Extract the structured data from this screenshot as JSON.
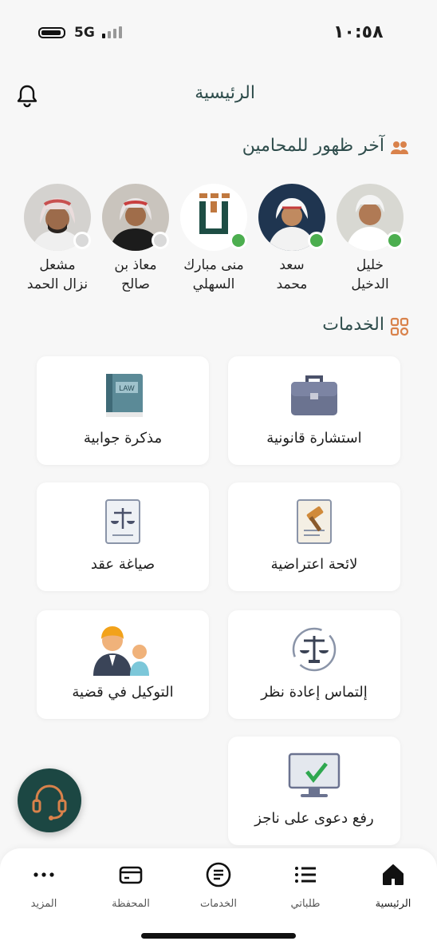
{
  "status_bar": {
    "time": "١٠:٥٨",
    "network": "5G"
  },
  "header": {
    "title": "الرئيسية"
  },
  "lawyers_section": {
    "title": "آخر ظهور للمحامين",
    "items": [
      {
        "name": "خليل\nالدخيل",
        "online": true
      },
      {
        "name": "سعد\nمحمد",
        "online": true
      },
      {
        "name": "منى مبارك\nالسهلي",
        "online": true
      },
      {
        "name": "معاذ بن\nصالح",
        "online": false
      },
      {
        "name": "مشعل\nنزال الحمد",
        "online": false
      }
    ]
  },
  "services_section": {
    "title": "الخدمات",
    "items": [
      {
        "label": "استشارة قانونية",
        "icon": "briefcase-icon"
      },
      {
        "label": "مذكرة جوابية",
        "icon": "law-book-icon"
      },
      {
        "label": "لائحة اعتراضية",
        "icon": "gavel-scroll-icon"
      },
      {
        "label": "صياغة عقد",
        "icon": "scales-scroll-icon"
      },
      {
        "label": "إلتماس إعادة نظر",
        "icon": "scales-refresh-icon"
      },
      {
        "label": "التوكيل في قضية",
        "icon": "people-icon"
      },
      {
        "label": "رفع دعوى على ناجز",
        "icon": "monitor-check-icon"
      }
    ]
  },
  "bottom_nav": {
    "items": [
      {
        "label": "الرئيسية",
        "icon": "home-icon",
        "active": true
      },
      {
        "label": "طلباتي",
        "icon": "list-icon",
        "active": false
      },
      {
        "label": "الخدمات",
        "icon": "services-icon",
        "active": false
      },
      {
        "label": "المحفظة",
        "icon": "wallet-icon",
        "active": false
      },
      {
        "label": "المزيد",
        "icon": "more-icon",
        "active": false
      }
    ]
  },
  "colors": {
    "accent": "#2f4d4c",
    "icon_orange": "#d9824b",
    "online": "#4cae4f",
    "offline": "#d9d9d9",
    "fab": "#1c4743"
  }
}
